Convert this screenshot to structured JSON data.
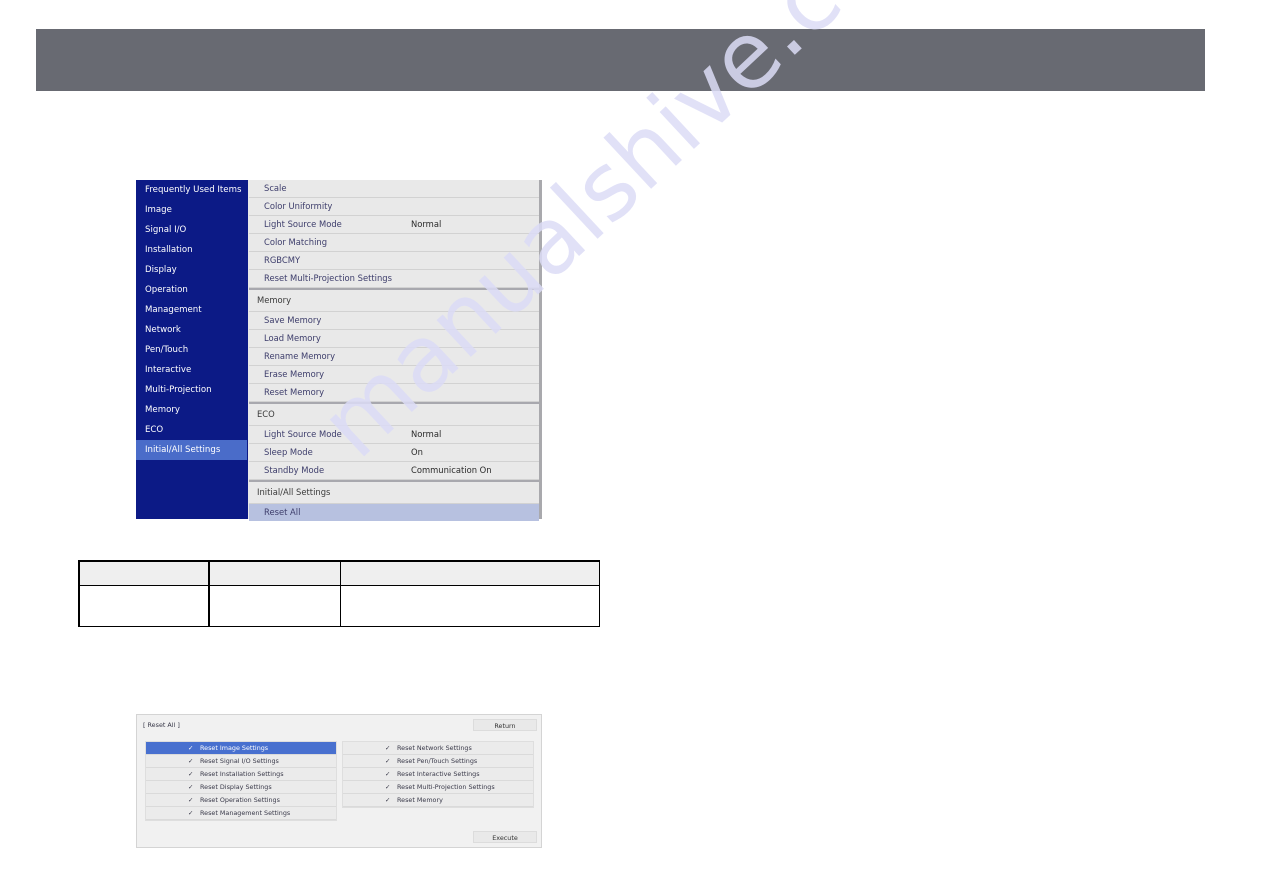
{
  "header": {
    "color": "#686a72"
  },
  "menu": {
    "sidebar": {
      "items": [
        {
          "label": "Frequently Used Items",
          "active": false
        },
        {
          "label": "Image",
          "active": false
        },
        {
          "label": "Signal I/O",
          "active": false
        },
        {
          "label": "Installation",
          "active": false
        },
        {
          "label": "Display",
          "active": false
        },
        {
          "label": "Operation",
          "active": false
        },
        {
          "label": "Management",
          "active": false
        },
        {
          "label": "Network",
          "active": false
        },
        {
          "label": "Pen/Touch",
          "active": false
        },
        {
          "label": "Interactive",
          "active": false
        },
        {
          "label": "Multi-Projection",
          "active": false
        },
        {
          "label": "Memory",
          "active": false
        },
        {
          "label": "ECO",
          "active": false
        },
        {
          "label": "Initial/All Settings",
          "active": true
        }
      ]
    },
    "content": {
      "multi_projection_items": [
        {
          "label": "Scale",
          "value": ""
        },
        {
          "label": "Color Uniformity",
          "value": ""
        },
        {
          "label": "Light Source Mode",
          "value": "Normal"
        },
        {
          "label": "Color Matching",
          "value": ""
        },
        {
          "label": "RGBCMY",
          "value": ""
        },
        {
          "label": "Reset Multi-Projection Settings",
          "value": ""
        }
      ],
      "memory_section": "Memory",
      "memory_items": [
        {
          "label": "Save Memory"
        },
        {
          "label": "Load Memory"
        },
        {
          "label": "Rename Memory"
        },
        {
          "label": "Erase Memory"
        },
        {
          "label": "Reset Memory"
        }
      ],
      "eco_section": "ECO",
      "eco_items": [
        {
          "label": "Light Source Mode",
          "value": "Normal"
        },
        {
          "label": "Sleep Mode",
          "value": "On"
        },
        {
          "label": "Standby Mode",
          "value": "Communication On"
        }
      ],
      "initial_section": "Initial/All Settings",
      "initial_items": [
        {
          "label": "Reset All",
          "selected": true
        }
      ]
    }
  },
  "table": {
    "headers": [
      "",
      "",
      ""
    ],
    "rows": [
      [
        "",
        "",
        ""
      ]
    ]
  },
  "dialog": {
    "title": "[ Reset All ]",
    "return_label": "Return",
    "execute_label": "Execute",
    "check_glyph": "✓",
    "left_items": [
      {
        "label": "Reset Image Settings",
        "selected": true
      },
      {
        "label": "Reset Signal I/O Settings",
        "selected": false
      },
      {
        "label": "Reset Installation Settings",
        "selected": false
      },
      {
        "label": "Reset Display Settings",
        "selected": false
      },
      {
        "label": "Reset Operation Settings",
        "selected": false
      },
      {
        "label": "Reset Management Settings",
        "selected": false
      }
    ],
    "right_items": [
      {
        "label": "Reset Network Settings"
      },
      {
        "label": "Reset Pen/Touch Settings"
      },
      {
        "label": "Reset Interactive Settings"
      },
      {
        "label": "Reset Multi-Projection Settings"
      },
      {
        "label": "Reset Memory"
      }
    ]
  },
  "watermark": "manualshive.com"
}
